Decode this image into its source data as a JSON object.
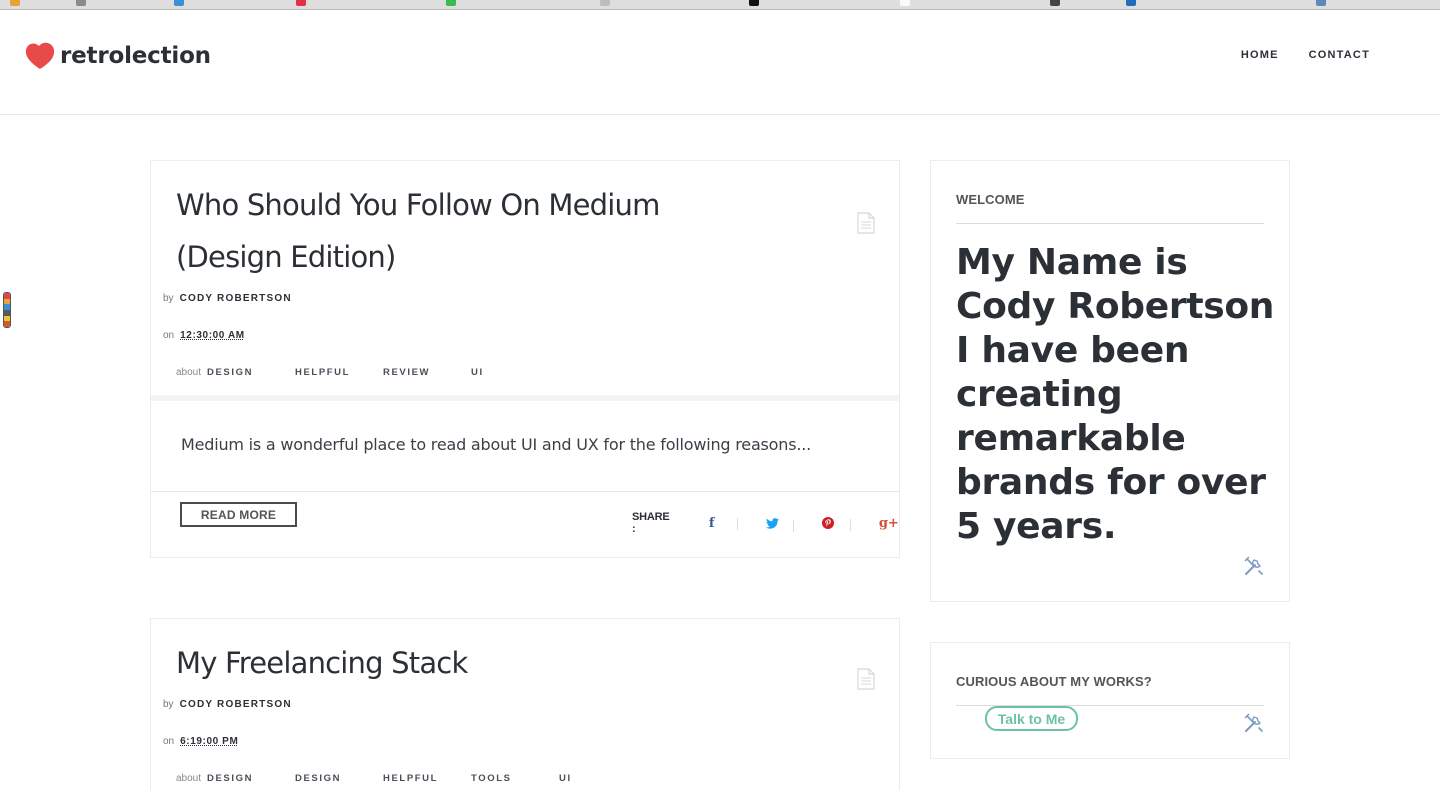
{
  "header": {
    "logo_text": "retrolection",
    "nav": [
      {
        "label": "HOME"
      },
      {
        "label": "CONTACT"
      }
    ]
  },
  "posts": [
    {
      "title_line1": "Who Should You Follow On Medium",
      "title_line2": "(Design Edition)",
      "by_label": "by",
      "author": "CODY ROBERTSON",
      "on_label": "on",
      "time": "12:30:00 AM",
      "about_label": "about",
      "tags": [
        "DESIGN",
        "HELPFUL",
        "REVIEW",
        "UI"
      ],
      "excerpt": "Medium is a wonderful place to read about UI and UX for the following reasons...",
      "read_more": "READ MORE",
      "share_label": "SHARE :"
    },
    {
      "title_line1": "My Freelancing Stack",
      "by_label": "by",
      "author": "CODY ROBERTSON",
      "on_label": "on",
      "time": "6:19:00 PM",
      "about_label": "about",
      "tags": [
        "DESIGN",
        "DESIGN",
        "HELPFUL",
        "TOOLS",
        "UI"
      ]
    }
  ],
  "sidebar": {
    "welcome": {
      "title": "WELCOME",
      "text": "My Name is Cody Robertson I have been creating remarkable brands for over 5 years."
    },
    "works": {
      "title": "CURIOUS ABOUT MY WORKS?",
      "button": "Talk to Me"
    }
  },
  "icons": {
    "logo": "heart-icon",
    "post": "document-icon",
    "widget": "tools-icon",
    "share": [
      "facebook-icon",
      "twitter-icon",
      "pinterest-icon",
      "google-plus-icon"
    ]
  },
  "colors": {
    "brand": "#e84a4a",
    "text": "#2b2f36",
    "accent_button": "#6cc3a2",
    "facebook": "#3b5998",
    "twitter": "#1da1f2",
    "pinterest": "#cb2027",
    "google_plus": "#dd4b39"
  }
}
